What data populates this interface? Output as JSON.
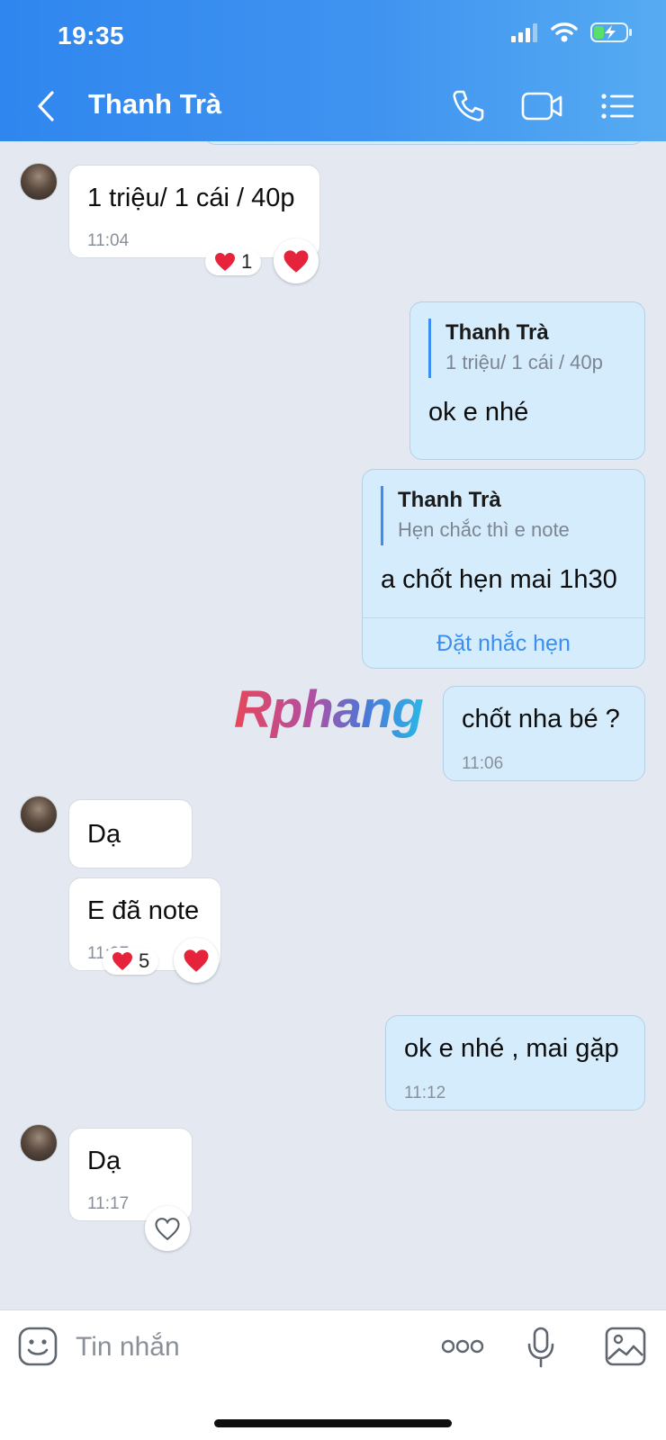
{
  "status_bar": {
    "time": "19:35"
  },
  "header": {
    "title": "Thanh Trà"
  },
  "messages": [
    {
      "text": "1 triệu/ 1 cái / 40p",
      "time": "11:04",
      "reaction_count": "1"
    },
    {
      "quote_name": "Thanh Trà",
      "quote_text": "1 triệu/ 1 cái / 40p",
      "text": "ok e nhé"
    },
    {
      "quote_name": "Thanh Trà",
      "quote_text": "Hẹn chắc thì e note",
      "text": "a chốt hẹn mai 1h30",
      "action": "Đặt nhắc hẹn"
    },
    {
      "text": "chốt nha bé ?",
      "time": "11:06"
    },
    {
      "text": "Dạ"
    },
    {
      "text": "E đã note",
      "time": "11:07",
      "reaction_count": "5"
    },
    {
      "text": "ok e nhé , mai gặp",
      "time": "11:12"
    },
    {
      "text": "Dạ",
      "time": "11:17"
    }
  ],
  "watermark": "Rphang",
  "composer": {
    "placeholder": "Tin nhắn"
  },
  "icons": {
    "back": "chevron-left-icon",
    "call": "phone-icon",
    "video": "video-camera-icon",
    "menu": "list-menu-icon",
    "sticker": "emoji-sticker-icon",
    "more": "more-dots-icon",
    "mic": "microphone-icon",
    "gallery": "image-gallery-icon",
    "reaction": "heart-icon"
  },
  "colors": {
    "header_start": "#2f86ee",
    "header_end": "#56abf2",
    "outgoing_bubble": "#d5ecfc",
    "incoming_bubble": "#ffffff",
    "chat_bg": "#e3e8f1",
    "accent": "#3b8ef0",
    "heart": "#e5243b"
  }
}
